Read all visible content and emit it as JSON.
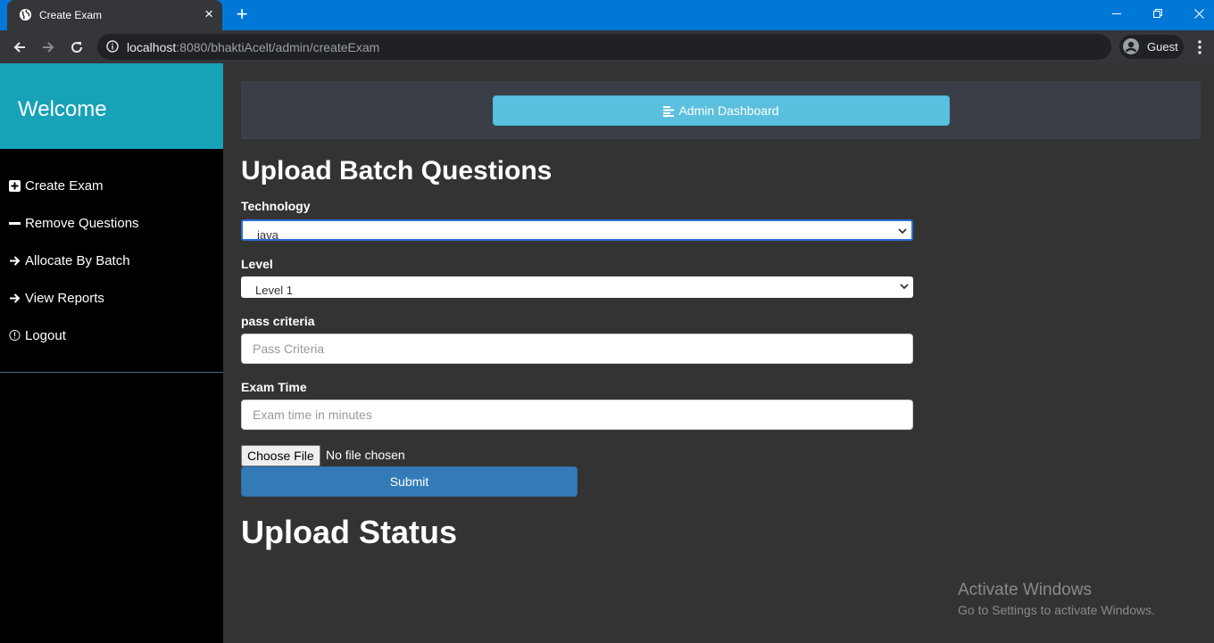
{
  "browser": {
    "tab_title": "Create Exam",
    "tab_close": "×",
    "new_tab": "+",
    "url_host": "localhost",
    "url_path": ":8080/bhaktiAcelt/admin/createExam",
    "profile_label": "Guest"
  },
  "sidebar": {
    "title": "Welcome",
    "items": [
      {
        "label": "Create Exam",
        "icon": "plus-square-icon"
      },
      {
        "label": "Remove Questions",
        "icon": "minus-icon"
      },
      {
        "label": "Allocate By Batch",
        "icon": "arrow-right-icon"
      },
      {
        "label": "View Reports",
        "icon": "arrow-right-icon"
      },
      {
        "label": "Logout",
        "icon": "alert-circle-icon"
      }
    ]
  },
  "main": {
    "dashboard_button": "Admin Dashboard",
    "title": "Upload Batch Questions",
    "technology": {
      "label": "Technology",
      "value": "java"
    },
    "level": {
      "label": "Level",
      "value": "Level 1"
    },
    "pass_criteria": {
      "label": "pass criteria",
      "placeholder": "Pass Criteria",
      "value": ""
    },
    "exam_time": {
      "label": "Exam Time",
      "placeholder": "Exam time in minutes",
      "value": ""
    },
    "file": {
      "button_label": "Choose File",
      "status": "No file chosen"
    },
    "submit_label": "Submit",
    "status_title": "Upload Status"
  },
  "watermark": {
    "title": "Activate Windows",
    "subtitle": "Go to Settings to activate Windows."
  },
  "colors": {
    "titlebar": "#0078d7",
    "sidebar_header": "#17a2b8",
    "info_button": "#5bc0de",
    "primary_button": "#337ab7",
    "page_background": "#333333"
  }
}
